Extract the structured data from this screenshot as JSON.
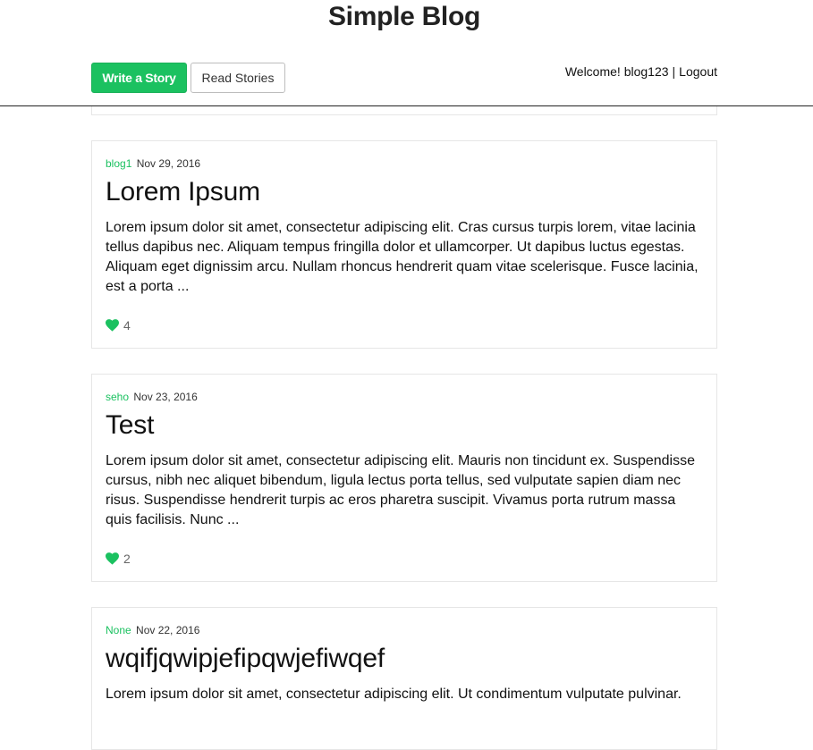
{
  "site": {
    "title": "Simple Blog"
  },
  "nav": {
    "write_label": "Write a Story",
    "read_label": "Read Stories",
    "welcome_text": "Welcome! blog123",
    "separator": "|",
    "logout_label": "Logout"
  },
  "colors": {
    "accent": "#1bc160",
    "border": "#e6e6e6"
  },
  "posts": [
    {
      "author": "blog1",
      "date": "Nov 29, 2016",
      "title": "Lorem Ipsum",
      "excerpt": "Lorem ipsum dolor sit amet, consectetur adipiscing elit. Cras cursus turpis lorem, vitae lacinia tellus dapibus nec. Aliquam tempus fringilla dolor et ullamcorper. Ut dapibus luctus egestas. Aliquam eget dignissim arcu. Nullam rhoncus hendrerit quam vitae scelerisque. Fusce lacinia, est a porta ...",
      "likes": "4",
      "like_icon": "heart-icon"
    },
    {
      "author": "seho",
      "date": "Nov 23, 2016",
      "title": "Test",
      "excerpt": "Lorem ipsum dolor sit amet, consectetur adipiscing elit. Mauris non tincidunt ex. Suspendisse cursus, nibh nec aliquet bibendum, ligula lectus porta tellus, sed vulputate sapien diam nec risus. Suspendisse hendrerit turpis ac eros pharetra suscipit. Vivamus porta rutrum massa quis facilisis. Nunc ...",
      "likes": "2",
      "like_icon": "heart-icon"
    },
    {
      "author": "None",
      "date": "Nov 22, 2016",
      "title": "wqifjqwipjefipqwjefiwqef",
      "excerpt": "Lorem ipsum dolor sit amet, consectetur adipiscing elit. Ut condimentum vulputate pulvinar."
    }
  ]
}
